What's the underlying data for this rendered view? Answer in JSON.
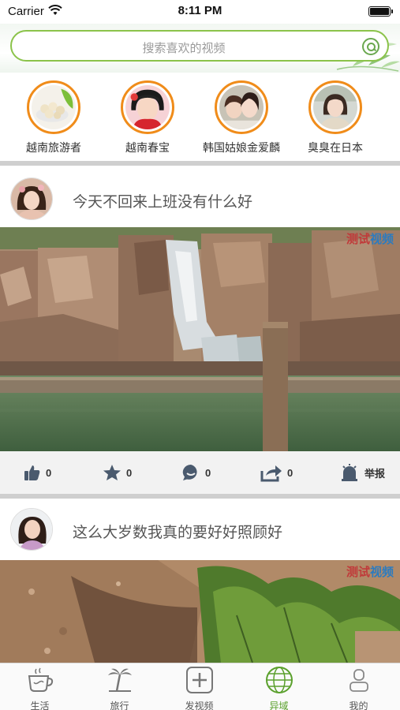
{
  "status_bar": {
    "carrier": "Carrier",
    "time": "8:11 PM"
  },
  "search": {
    "placeholder": "搜索喜欢的视频"
  },
  "featured_users": [
    {
      "name": "越南旅游者"
    },
    {
      "name": "越南春宝"
    },
    {
      "name": "韩国姑娘金爱麟"
    },
    {
      "name": "臭臭在日本"
    }
  ],
  "posts": [
    {
      "title": "今天不回来上班没有什么好",
      "watermark_a": "测试",
      "watermark_b": "视频",
      "likes": "0",
      "favorites": "0",
      "comments": "0",
      "shares": "0",
      "report_label": "举报"
    },
    {
      "title": "这么大岁数我真的要好好照顾好",
      "watermark_a": "测试",
      "watermark_b": "视频"
    }
  ],
  "tabs": [
    {
      "label": "生活",
      "icon": "coffee-cup-icon"
    },
    {
      "label": "旅行",
      "icon": "palm-tree-icon"
    },
    {
      "label": "发视频",
      "icon": "plus-square-icon"
    },
    {
      "label": "异域",
      "icon": "globe-icon",
      "active": true
    },
    {
      "label": "我的",
      "icon": "user-icon"
    }
  ],
  "colors": {
    "accent": "#5aa02c",
    "avatar_ring": "#f08c1a",
    "search_border": "#8bc34a"
  }
}
